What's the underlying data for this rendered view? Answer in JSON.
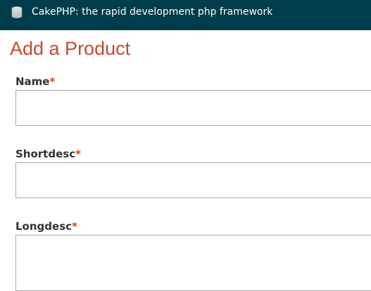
{
  "header": {
    "title": "CakePHP: the rapid development php framework",
    "logo_icon": "database-stack-icon",
    "background_color": "#003d4c"
  },
  "page": {
    "title": "Add a Product",
    "title_color": "#c6492c"
  },
  "form": {
    "required_marker": "*",
    "required_marker_color": "#dd3c10",
    "fields": [
      {
        "label": "Name",
        "value": ""
      },
      {
        "label": "Shortdesc",
        "value": ""
      },
      {
        "label": "Longdesc",
        "value": ""
      }
    ]
  }
}
